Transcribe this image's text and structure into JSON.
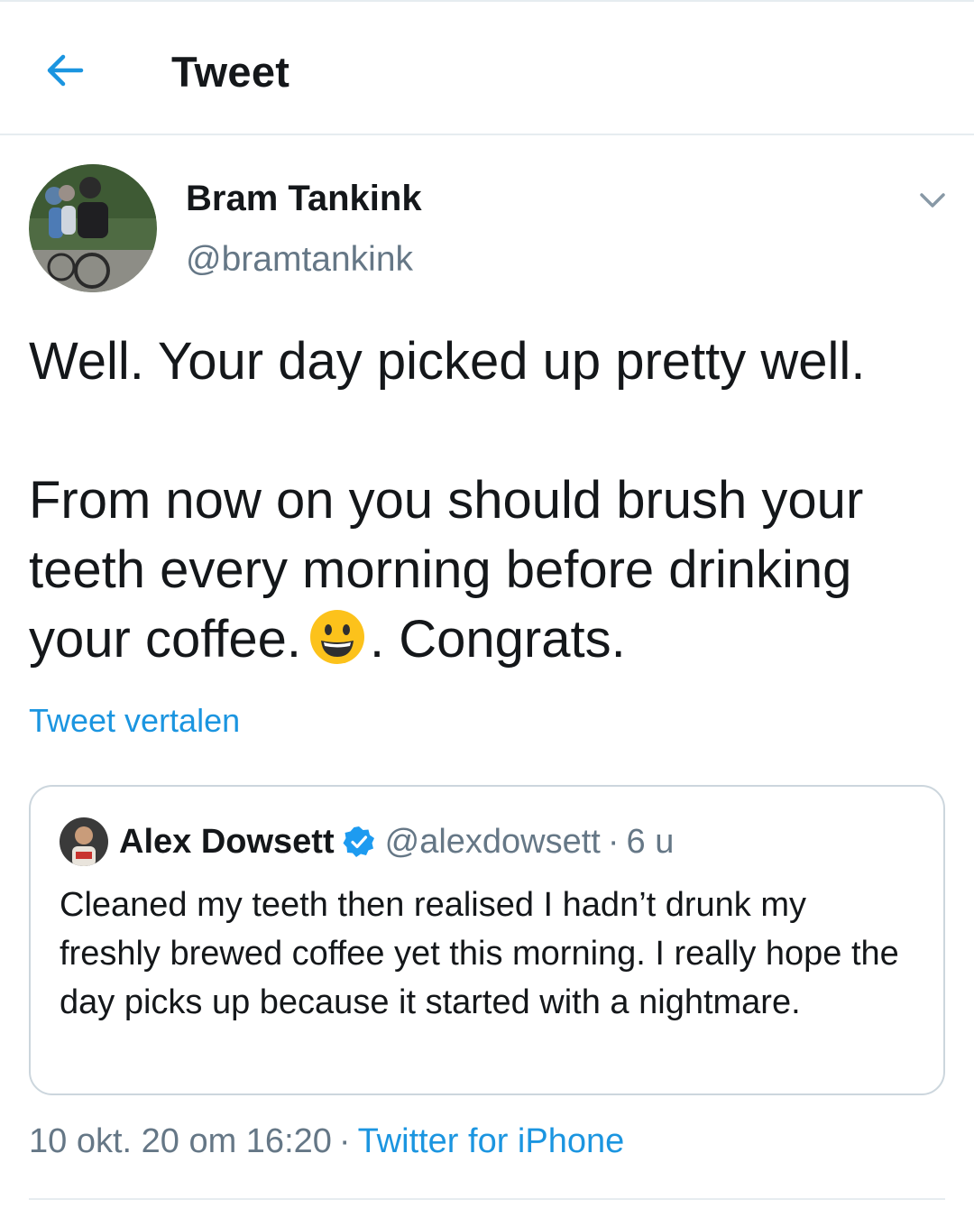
{
  "header": {
    "back_icon": "arrow-left-icon",
    "title": "Tweet"
  },
  "tweet": {
    "author_name": "Bram Tankink",
    "author_handle": "@bramtankink",
    "text_line1": "Well. Your day picked up pretty well.",
    "text_para2_a": "From now on you should brush your teeth every morning before drinking your coffee.",
    "text_para2_b": ". Congrats.",
    "emoji": "grinning-face-emoji",
    "translate_label": "Tweet vertalen",
    "timestamp": "10 okt. 20 om 16:20",
    "separator": "·",
    "source": "Twitter for iPhone"
  },
  "quote": {
    "name": "Alex Dowsett",
    "handle": "@alexdowsett",
    "separator": "·",
    "time": "6 u",
    "text": "Cleaned my teeth then realised I hadn’t drunk my freshly brewed coffee yet this morning. I really hope the day picks up because it started with a nightmare."
  },
  "colors": {
    "accent": "#1b95e0",
    "text": "#14171a",
    "muted": "#657786",
    "border": "#ccd6dd"
  }
}
